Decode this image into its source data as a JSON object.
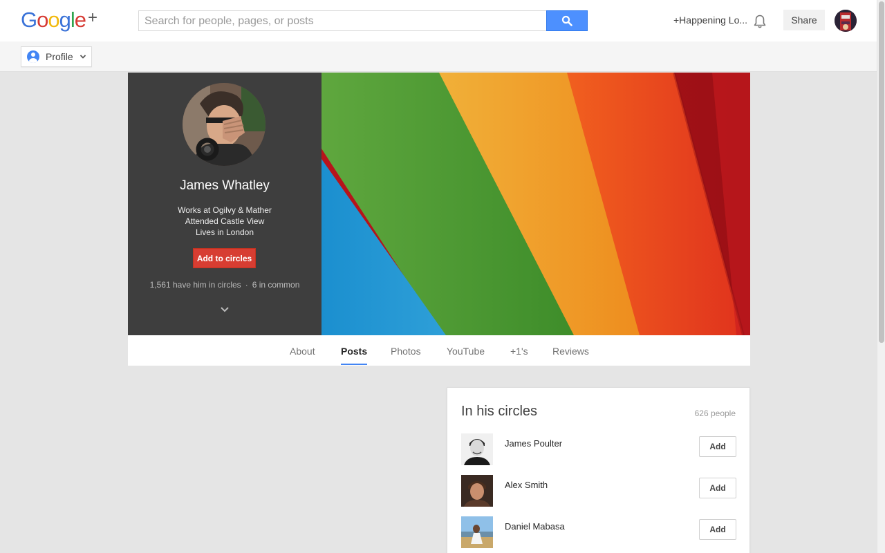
{
  "header": {
    "logo": {
      "letters": [
        {
          "char": "G",
          "color": "#3b73d8"
        },
        {
          "char": "o",
          "color": "#d73b34"
        },
        {
          "char": "o",
          "color": "#f2b90c"
        },
        {
          "char": "g",
          "color": "#3b73d8"
        },
        {
          "char": "l",
          "color": "#2ea44d"
        },
        {
          "char": "e",
          "color": "#d73b34"
        }
      ],
      "plus": "+"
    },
    "search_placeholder": "Search for people, pages, or posts",
    "search_icon": "search-icon",
    "happening": "+Happening Lo...",
    "notifications_icon": "bell-icon",
    "share_label": "Share"
  },
  "subbar": {
    "profile_label": "Profile"
  },
  "profile": {
    "name": "James Whatley",
    "work": "Works at Ogilvy & Mather",
    "school": "Attended Castle View",
    "location": "Lives in London",
    "add_button": "Add to circles",
    "circled_by": "1,561 have him in circles",
    "dot": "·",
    "in_common": "6 in common"
  },
  "tabs": [
    {
      "label": "About",
      "active": false
    },
    {
      "label": "Posts",
      "active": true
    },
    {
      "label": "Photos",
      "active": false
    },
    {
      "label": "YouTube",
      "active": false
    },
    {
      "label": "+1's",
      "active": false
    },
    {
      "label": "Reviews",
      "active": false
    }
  ],
  "circles_card": {
    "title": "In his circles",
    "count": "626 people",
    "people": [
      {
        "name": "James Poulter",
        "add_label": "Add"
      },
      {
        "name": "Alex Smith",
        "add_label": "Add"
      },
      {
        "name": "Daniel Mabasa",
        "add_label": "Add"
      }
    ]
  },
  "colors": {
    "search_blue": "#4d90fe",
    "add_red": "#d73d32",
    "tab_underline": "#4285f4",
    "profile_panel": "#3e3e3e"
  }
}
